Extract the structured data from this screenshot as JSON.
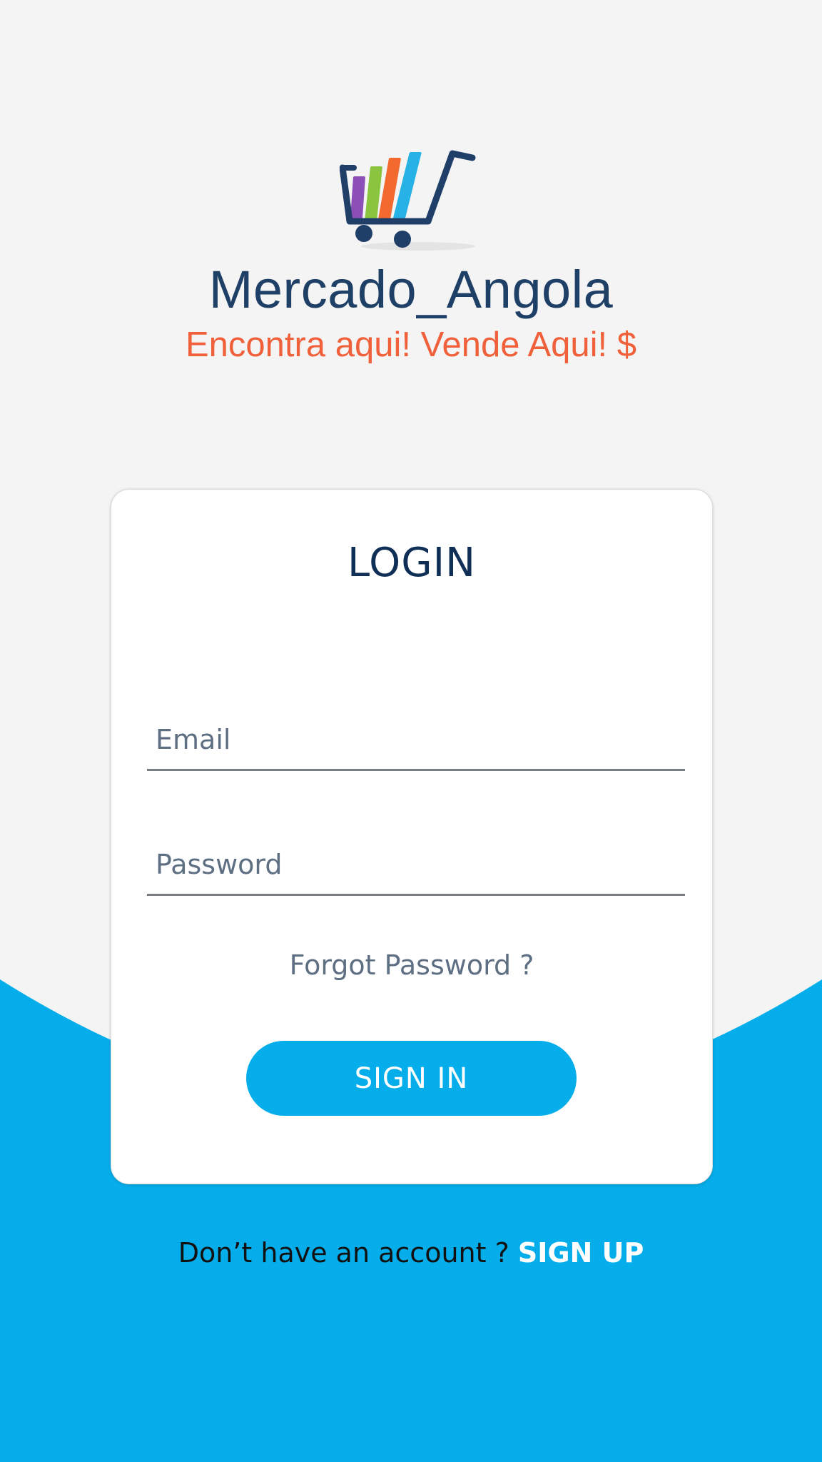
{
  "colors": {
    "background": "#f4f4f5",
    "accent_blue": "#05aeea",
    "brand_navy": "#1e3f66",
    "tagline_orange": "#f0603a",
    "title_navy": "#102f57",
    "muted_text": "#5e6f84"
  },
  "brand": {
    "logo_icon": "shopping-cart-icon",
    "name": "Mercado_Angola",
    "tagline": "Encontra aqui! Vende Aqui! $"
  },
  "login_card": {
    "title": "LOGIN",
    "email_placeholder": "Email",
    "email_value": "",
    "password_placeholder": "Password",
    "password_value": "",
    "forgot_password": "Forgot Password ?",
    "sign_in_label": "SIGN IN"
  },
  "footer": {
    "prompt": "Don’t have an account ?",
    "sign_up_label": "SIGN UP"
  }
}
